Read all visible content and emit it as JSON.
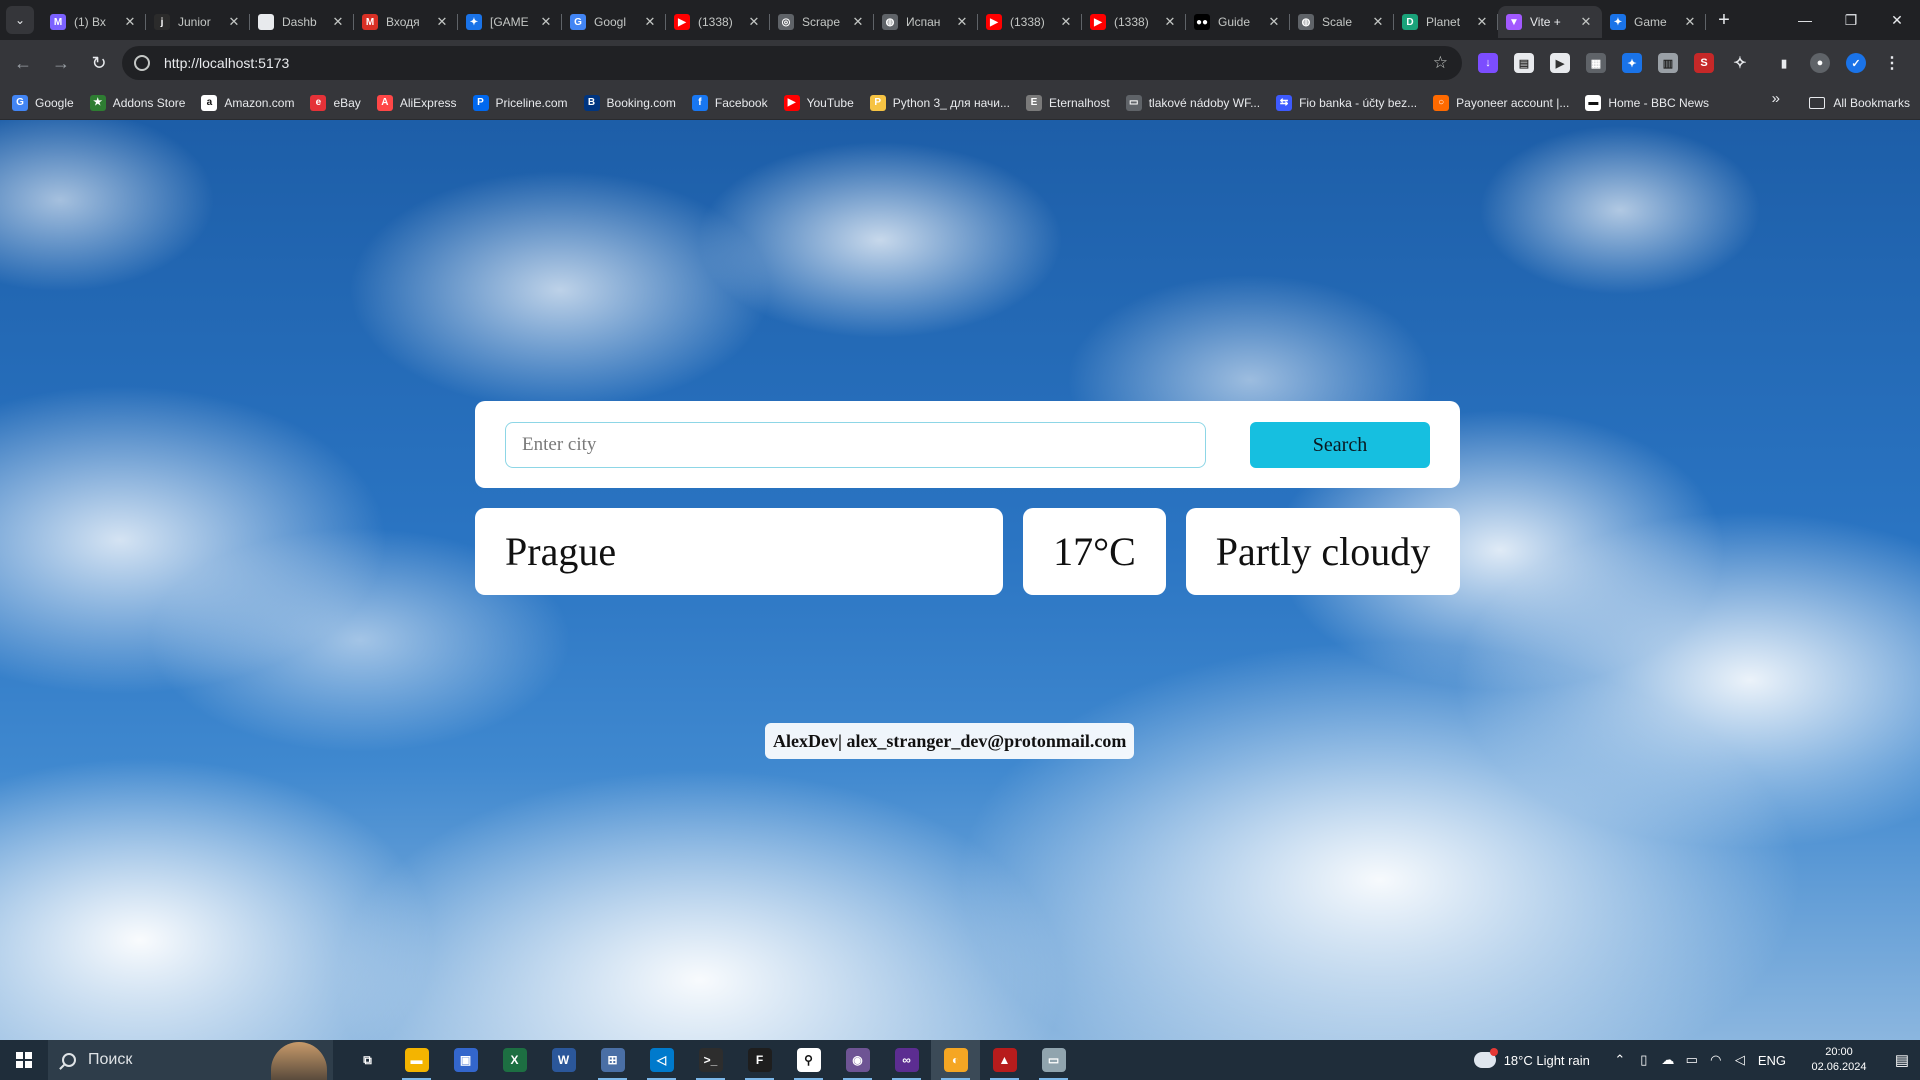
{
  "browser": {
    "tabs": [
      {
        "title": "(1) Вх",
        "icon": "gmail-icon",
        "color": "#7b61ff",
        "glyph": "M"
      },
      {
        "title": "Junior",
        "icon": "j-icon",
        "color": "#2b2b2b",
        "glyph": "j"
      },
      {
        "title": "Dashb",
        "icon": "doc-icon",
        "color": "#e8eaed",
        "glyph": ""
      },
      {
        "title": "Входя",
        "icon": "gmail-icon",
        "color": "#d93025",
        "glyph": "M"
      },
      {
        "title": "[GAME",
        "icon": "puzzle-icon",
        "color": "#1a73e8",
        "glyph": "✦"
      },
      {
        "title": "Googl",
        "icon": "translate-icon",
        "color": "#4285f4",
        "glyph": "G"
      },
      {
        "title": "(1338)",
        "icon": "youtube-icon",
        "color": "#ff0000",
        "glyph": "▶"
      },
      {
        "title": "Scrape",
        "icon": "openai-icon",
        "color": "#5f6368",
        "glyph": "◎"
      },
      {
        "title": "Испан",
        "icon": "globe-icon",
        "color": "#5f6368",
        "glyph": "◍"
      },
      {
        "title": "(1338)",
        "icon": "youtube-icon",
        "color": "#ff0000",
        "glyph": "▶"
      },
      {
        "title": "(1338)",
        "icon": "youtube-icon",
        "color": "#ff0000",
        "glyph": "▶"
      },
      {
        "title": "Guide",
        "icon": "medium-icon",
        "color": "#000000",
        "glyph": "●●"
      },
      {
        "title": "Scale",
        "icon": "globe-icon",
        "color": "#5f6368",
        "glyph": "◍"
      },
      {
        "title": "Planet",
        "icon": "d-icon",
        "color": "#1aa37a",
        "glyph": "D"
      },
      {
        "title": "Vite +",
        "icon": "vite-icon",
        "color": "#a259ff",
        "glyph": "▼"
      },
      {
        "title": "Game",
        "icon": "puzzle-icon",
        "color": "#1a73e8",
        "glyph": "✦"
      }
    ],
    "url": "http://localhost:5173",
    "bookmarks": [
      {
        "label": "Google",
        "icon": "google-icon",
        "color": "#4285f4",
        "glyph": "G"
      },
      {
        "label": "Addons Store",
        "icon": "addons-icon",
        "color": "#2e7d32",
        "glyph": "★"
      },
      {
        "label": "Amazon.com",
        "icon": "amazon-icon",
        "color": "#ffffff",
        "glyph": "a"
      },
      {
        "label": "eBay",
        "icon": "ebay-icon",
        "color": "#e53238",
        "glyph": "e"
      },
      {
        "label": "AliExpress",
        "icon": "aliexpress-icon",
        "color": "#ff4747",
        "glyph": "A"
      },
      {
        "label": "Priceline.com",
        "icon": "priceline-icon",
        "color": "#0068ef",
        "glyph": "P"
      },
      {
        "label": "Booking.com",
        "icon": "booking-icon",
        "color": "#003580",
        "glyph": "B"
      },
      {
        "label": "Facebook",
        "icon": "facebook-icon",
        "color": "#1877f2",
        "glyph": "f"
      },
      {
        "label": "YouTube",
        "icon": "youtube-icon",
        "color": "#ff0000",
        "glyph": "▶"
      },
      {
        "label": "Python 3_ для начи...",
        "icon": "python-icon",
        "color": "#f6c343",
        "glyph": "P"
      },
      {
        "label": "Eternalhost",
        "icon": "eternalhost-icon",
        "color": "#7a7a7a",
        "glyph": "E"
      },
      {
        "label": "tlakové nádoby WF...",
        "icon": "page-icon",
        "color": "#5f6368",
        "glyph": "▭"
      },
      {
        "label": "Fio banka - účty bez...",
        "icon": "fio-icon",
        "color": "#3d5afe",
        "glyph": "⇆"
      },
      {
        "label": "Payoneer account |...",
        "icon": "payoneer-icon",
        "color": "#ff6a00",
        "glyph": "○"
      },
      {
        "label": "Home - BBC News",
        "icon": "bbc-icon",
        "color": "#ffffff",
        "glyph": "▬"
      }
    ],
    "all_bookmarks_label": "All Bookmarks"
  },
  "app": {
    "search": {
      "placeholder": "Enter city",
      "value": "",
      "button_label": "Search"
    },
    "result": {
      "city": "Prague",
      "temperature": "17°C",
      "condition": "Partly cloudy"
    },
    "footer": "AlexDev| alex_stranger_dev@protonmail.com",
    "colors": {
      "button": "#16bfe0",
      "input_border": "#8dd6e6",
      "card": "#ffffff"
    }
  },
  "taskbar": {
    "search_placeholder": "Поиск",
    "weather": "18°C  Light rain",
    "language": "ENG",
    "time": "20:00",
    "date": "02.06.2024",
    "apps": [
      {
        "icon": "task-view-icon",
        "color": "transparent",
        "glyph": "⧉"
      },
      {
        "icon": "file-explorer-icon",
        "color": "#f4b400",
        "glyph": "▬"
      },
      {
        "icon": "save-icon",
        "color": "#3366cc",
        "glyph": "▣"
      },
      {
        "icon": "excel-icon",
        "color": "#1d6f42",
        "glyph": "X"
      },
      {
        "icon": "word-icon",
        "color": "#2b579a",
        "glyph": "W"
      },
      {
        "icon": "network-icon",
        "color": "#4a6fa5",
        "glyph": "⊞"
      },
      {
        "icon": "vscode-icon",
        "color": "#007acc",
        "glyph": "◁"
      },
      {
        "icon": "terminal-icon",
        "color": "#2d2d2d",
        "glyph": ">_"
      },
      {
        "icon": "figma-icon",
        "color": "#1e1e1e",
        "glyph": "F"
      },
      {
        "icon": "git-icon",
        "color": "#ffffff",
        "glyph": "⚲"
      },
      {
        "icon": "github-icon",
        "color": "#6e5494",
        "glyph": "◉"
      },
      {
        "icon": "visual-studio-icon",
        "color": "#5c2d91",
        "glyph": "∞"
      },
      {
        "icon": "browser-icon",
        "color": "#f5a623",
        "glyph": "◐"
      },
      {
        "icon": "game-icon",
        "color": "#b71c1c",
        "glyph": "▲"
      },
      {
        "icon": "monitor-icon",
        "color": "#90a4ae",
        "glyph": "▭"
      }
    ]
  }
}
